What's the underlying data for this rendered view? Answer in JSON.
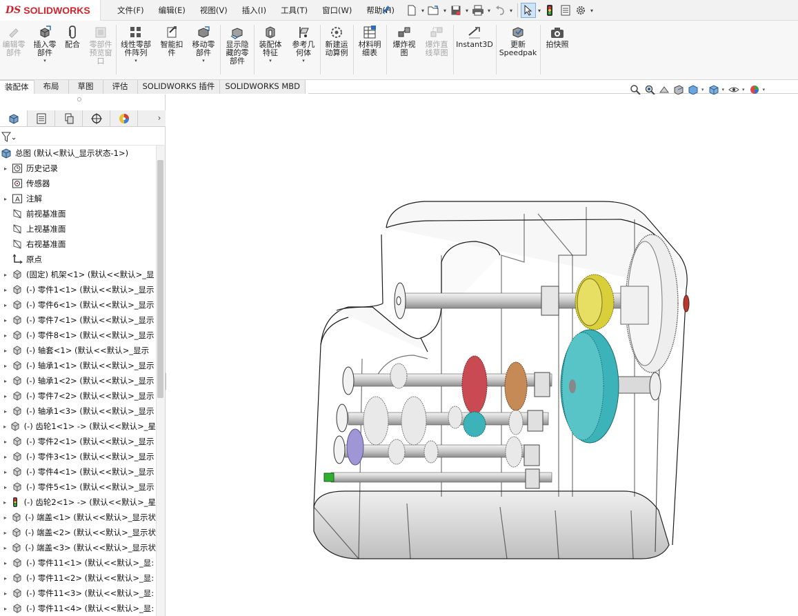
{
  "app": {
    "logo_ds": "DS",
    "logo_text": "SOLIDWORKS"
  },
  "menu": [
    "文件(F)",
    "编辑(E)",
    "视图(V)",
    "插入(I)",
    "工具(T)",
    "窗口(W)",
    "帮助(H)"
  ],
  "ribbon": {
    "buttons": [
      {
        "label": "编辑零\n部件",
        "disabled": true
      },
      {
        "label": "插入零\n部件",
        "disabled": false,
        "arrow": true
      },
      {
        "label": "配合",
        "disabled": false
      },
      {
        "label": "零部件\n预览窗\n口",
        "disabled": true
      },
      {
        "label": "线性零部\n件阵列",
        "disabled": false,
        "arrow": true
      },
      {
        "label": "智能扣\n件",
        "disabled": false
      },
      {
        "label": "移动零\n部件",
        "disabled": false,
        "arrow": true
      },
      {
        "label": "显示隐\n藏的零\n部件",
        "disabled": false
      },
      {
        "label": "装配体\n特征",
        "disabled": false,
        "arrow": true
      },
      {
        "label": "参考几\n何体",
        "disabled": false,
        "arrow": true
      },
      {
        "label": "新建运\n动算例",
        "disabled": false
      },
      {
        "label": "材料明\n细表",
        "disabled": false
      },
      {
        "label": "爆炸视\n图",
        "disabled": false
      },
      {
        "label": "爆炸直\n线草图",
        "disabled": true
      },
      {
        "label": "Instant3D",
        "disabled": false
      },
      {
        "label": "更新\nSpeedpak",
        "disabled": false
      },
      {
        "label": "拍快照",
        "disabled": false
      }
    ]
  },
  "tabs": [
    "装配体",
    "布局",
    "草图",
    "评估",
    "SOLIDWORKS 插件",
    "SOLIDWORKS MBD"
  ],
  "tree": {
    "root": "总图 (默认<默认_显示状态-1>)",
    "items": [
      {
        "label": "历史记录",
        "icon": "history-icon",
        "expand": true
      },
      {
        "label": "传感器",
        "icon": "sensor-icon",
        "expand": false
      },
      {
        "label": "注解",
        "icon": "annotation-icon",
        "expand": true
      },
      {
        "label": "前视基准面",
        "icon": "plane-icon",
        "expand": false
      },
      {
        "label": "上视基准面",
        "icon": "plane-icon",
        "expand": false
      },
      {
        "label": "右视基准面",
        "icon": "plane-icon",
        "expand": false
      },
      {
        "label": "原点",
        "icon": "origin-icon",
        "expand": false
      },
      {
        "label": "(固定) 机架<1> (默认<<默认>_显",
        "icon": "part-icon",
        "expand": true
      },
      {
        "label": "(-) 零件1<1> (默认<<默认>_显示",
        "icon": "part-icon",
        "expand": true
      },
      {
        "label": "(-) 零件6<1> (默认<<默认>_显示",
        "icon": "part-icon",
        "expand": true
      },
      {
        "label": "(-) 零件7<1> (默认<<默认>_显示",
        "icon": "part-icon",
        "expand": true
      },
      {
        "label": "(-) 零件8<1> (默认<<默认>_显示",
        "icon": "part-icon",
        "expand": true
      },
      {
        "label": "(-) 轴套<1> (默认<<默认>_显示",
        "icon": "part-icon",
        "expand": true
      },
      {
        "label": "(-) 轴承1<1> (默认<<默认>_显示",
        "icon": "part-icon",
        "expand": true
      },
      {
        "label": "(-) 轴承1<2> (默认<<默认>_显示",
        "icon": "part-icon",
        "expand": true
      },
      {
        "label": "(-) 零件7<2> (默认<<默认>_显示",
        "icon": "part-icon",
        "expand": true
      },
      {
        "label": "(-) 轴承1<3> (默认<<默认>_显示",
        "icon": "part-icon",
        "expand": true
      },
      {
        "label": "(-) 齿轮1<1> -> (默认<<默认>_星",
        "icon": "part-icon",
        "expand": true
      },
      {
        "label": "(-) 零件2<1> (默认<<默认>_显示",
        "icon": "part-icon",
        "expand": true
      },
      {
        "label": "(-) 零件3<1> (默认<<默认>_显示",
        "icon": "part-icon",
        "expand": true
      },
      {
        "label": "(-) 零件4<1> (默认<<默认>_显示",
        "icon": "part-icon",
        "expand": true
      },
      {
        "label": "(-) 零件5<1> (默认<<默认>_显示",
        "icon": "part-icon",
        "expand": true
      },
      {
        "label": "(-) 齿轮2<1> -> (默认<<默认>_星",
        "icon": "gear-part-icon",
        "expand": true
      },
      {
        "label": "(-) 端盖<1> (默认<<默认>_显示状",
        "icon": "part-icon",
        "expand": true
      },
      {
        "label": "(-) 端盖<2> (默认<<默认>_显示状",
        "icon": "part-icon",
        "expand": true
      },
      {
        "label": "(-) 端盖<3> (默认<<默认>_显示状",
        "icon": "part-icon",
        "expand": true
      },
      {
        "label": "(-) 零件11<1> (默认<<默认>_显:",
        "icon": "part-icon",
        "expand": true
      },
      {
        "label": "(-) 零件11<2> (默认<<默认>_显:",
        "icon": "part-icon",
        "expand": true
      },
      {
        "label": "(-) 零件11<3> (默认<<默认>_显:",
        "icon": "part-icon",
        "expand": true
      },
      {
        "label": "(-) 零件11<4> (默认<<默认>_显:",
        "icon": "part-icon",
        "expand": true
      }
    ]
  },
  "colors": {
    "brand": "#d2232a",
    "gear_yellow": "#d8cf3a",
    "gear_teal": "#3bb3b8",
    "gear_red": "#c94a52",
    "gear_tan": "#c58a55",
    "gear_lavender": "#9f96d6",
    "gear_green": "#2fae2f"
  }
}
